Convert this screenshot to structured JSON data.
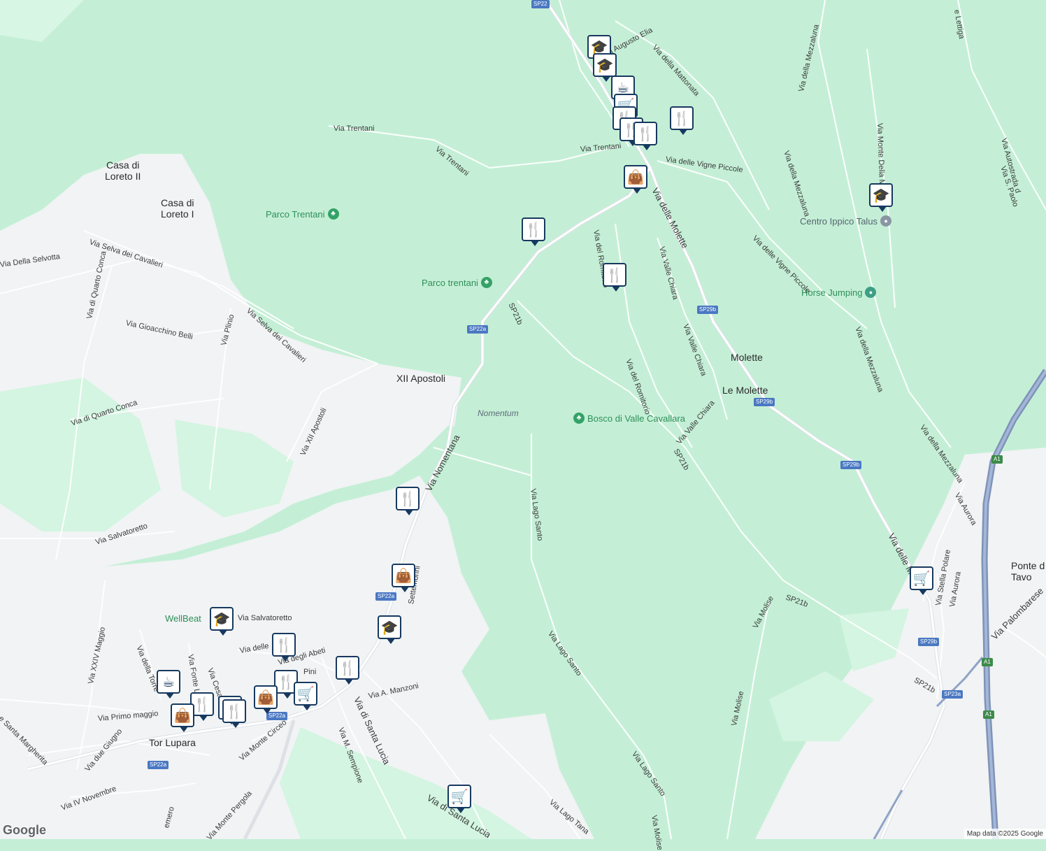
{
  "colors": {
    "park": "#c4efd6",
    "urban": "#f1f3f4",
    "road": "#ffffff",
    "highway": "#8fa3c6",
    "marker_border": "#17395f"
  },
  "places": {
    "casa_loreto_2": "Casa di\nLoreto II",
    "casa_loreto_1": "Casa di\nLoreto I",
    "xii_apostoli": "XII Apostoli",
    "molette": "Molette",
    "le_molette": "Le Molette",
    "tor_lupara": "Tor Lupara",
    "ponte_tavo": "Ponte d\nTavo"
  },
  "parks": {
    "parco_trentani_1": "Parco Trentani",
    "parco_trentani_2": "Parco trentani",
    "bosco": "Bosco di Valle Cavallara"
  },
  "pois": {
    "centro_ippico": "Centro Ippico Talus",
    "horse_jumping": "Horse Jumping",
    "wellbeat": "WellBeat"
  },
  "areas": {
    "nomentum": "Nomentum"
  },
  "roads": {
    "via_trentani_a": "Via Trentani",
    "via_trentani_b": "Via Trentani",
    "via_trentani_c": "Via Trentani",
    "via_augusto_elia": "Via Augusto Elia",
    "via_della_mattonata": "Via della Mattonata",
    "via_della_mezzaluna_a": "Via della Mezzaluna",
    "via_della_mezzaluna_b": "Via della Mezzaluna",
    "via_della_mezzaluna_c": "Via della Mezzaluna",
    "via_della_mezzaluna_d": "Via della Mezzaluna",
    "via_delle_vigne_piccole_a": "Via delle Vigne Piccole",
    "via_delle_vigne_piccole_b": "Via delle Vigne Piccole",
    "via_delle_molette_a": "Via delle Molette",
    "via_delle_molette_b": "Via delle Mo",
    "via_del_romitorio_a": "Via del Romitorio",
    "via_del_romitorio_b": "Via del Romitorio",
    "via_valle_chiara_a": "Via Valle Chiara",
    "via_valle_chiara_b": "Via Valle Chiara",
    "via_valle_chiara_c": "Via Valle Chiara",
    "via_selva_cavalieri_a": "Via Selva dei Cavalieri",
    "via_selva_cavalieri_b": "Via Selva dei Cavalieri",
    "via_della_selvotta": "Via Della Selvotta",
    "via_di_quarto_conca_a": "Via di Quarto Conca",
    "via_di_quarto_conca_b": "Via di Quarto Conca",
    "via_gioacchino_belli": "Via Gioacchino Belli",
    "via_plinio": "Via Plinio",
    "via_xii_apostoli": "Via XII Apostoli",
    "via_nomentana": "Via Nomentana",
    "via_salvatoretto": "Via Salvatoretto",
    "via_salvatoretto_b": "Via Salvatoretto",
    "via_lago_santo_a": "Via Lago Santo",
    "via_lago_santo_b": "Via Lago Santo",
    "via_lago_santo_c": "Via Lago Santo",
    "via_lago_tana": "Via Lago Tana",
    "via_molise_a": "Via Molise",
    "via_molise_b": "Via Molise",
    "via_molise_c": "Via Molise",
    "via_aurora_a": "Via Aurora",
    "via_aurora_b": "Via Aurora",
    "via_stella_polare": "Via Stella Polare",
    "via_palombarese": "Via Palombarese",
    "via_monte_della": "Via Monte Della Me",
    "via_autostrada": "Via Autostrada d",
    "via_s_paolo": "Via S. Paolo",
    "via_lettiga": "e Lettiga",
    "via_settembrini": "Settembrini",
    "via_di_santa_lucia_a": "Via di Santa Lucia",
    "via_di_santa_lucia_b": "Via di Santa Lucia",
    "via_m_sempione": "Via M. Sempione",
    "via_a_manzoni": "Via A. Manzoni",
    "via_xxiv_maggio": "Via XXIV Maggio",
    "via_della_torre": "Via della Torre",
    "via_fonte": "Via Fonte La",
    "via_cesare": "Via Cesare",
    "via_degli_abeti": "Via degli Abeti",
    "via_delle": "Via delle",
    "via_pini": "Pini",
    "via_primo_maggio": "Via Primo maggio",
    "via_santa_margherita": "e Santa Margherita",
    "via_due_giugno": "Via due Giugno",
    "via_monte_circeo": "Via Monte Circeo",
    "via_iv_novembre": "Via IV Novembre",
    "via_monte_pergola": "Via Monte Pergola",
    "via_emero": "emero",
    "sp21b_a": "SP21b",
    "sp21b_b": "SP21b",
    "sp21b_c": "SP21b",
    "sp21b_d": "SP21b"
  },
  "shields": {
    "sp22_top": "SP22",
    "sp22a_a": "SP22a",
    "sp22a_b": "SP22a",
    "sp22a_c": "SP22a",
    "sp22a_d": "SP22a",
    "sp29b_a": "SP29b",
    "sp29b_b": "SP29b",
    "sp29b_c": "SP29b",
    "sp29b_d": "SP29b",
    "sp23a": "SP23a",
    "a1_a": "A1",
    "a1_b": "A1",
    "a1_c": "A1"
  },
  "markers": [
    {
      "type": "school-icon",
      "glyph": "🎓"
    },
    {
      "type": "school-icon",
      "glyph": "🎓"
    },
    {
      "type": "cafe-icon",
      "glyph": "☕"
    },
    {
      "type": "grocery-icon",
      "glyph": "🛒"
    },
    {
      "type": "restaurant-icon",
      "glyph": "🍴"
    },
    {
      "type": "restaurant-icon",
      "glyph": "🍴"
    },
    {
      "type": "restaurant-icon",
      "glyph": "🍴"
    },
    {
      "type": "restaurant-icon",
      "glyph": "🍴"
    },
    {
      "type": "shopping-icon",
      "glyph": "👜"
    },
    {
      "type": "restaurant-icon",
      "glyph": "🍴"
    },
    {
      "type": "restaurant-icon",
      "glyph": "🍴"
    },
    {
      "type": "school-icon",
      "glyph": "🎓"
    },
    {
      "type": "restaurant-icon",
      "glyph": "🍴"
    },
    {
      "type": "shopping-icon",
      "glyph": "👜"
    },
    {
      "type": "school-icon",
      "glyph": "🎓"
    },
    {
      "type": "restaurant-icon",
      "glyph": "🍴"
    },
    {
      "type": "school-icon",
      "glyph": "🎓"
    },
    {
      "type": "restaurant-icon",
      "glyph": "🍴"
    },
    {
      "type": "restaurant-icon",
      "glyph": "🍴"
    },
    {
      "type": "cafe-icon",
      "glyph": "☕"
    },
    {
      "type": "grocery-icon",
      "glyph": "🛒"
    },
    {
      "type": "shopping-icon",
      "glyph": "👜"
    },
    {
      "type": "restaurant-icon",
      "glyph": "🍴"
    },
    {
      "type": "restaurant-icon",
      "glyph": "🍴"
    },
    {
      "type": "restaurant-icon",
      "glyph": "🍴"
    },
    {
      "type": "shopping-icon",
      "glyph": "👜"
    },
    {
      "type": "grocery-icon",
      "glyph": "🛒"
    },
    {
      "type": "grocery-icon",
      "glyph": "🛒"
    }
  ],
  "footer": {
    "logo": "Google",
    "attribution": "Map data ©2025 Google"
  }
}
